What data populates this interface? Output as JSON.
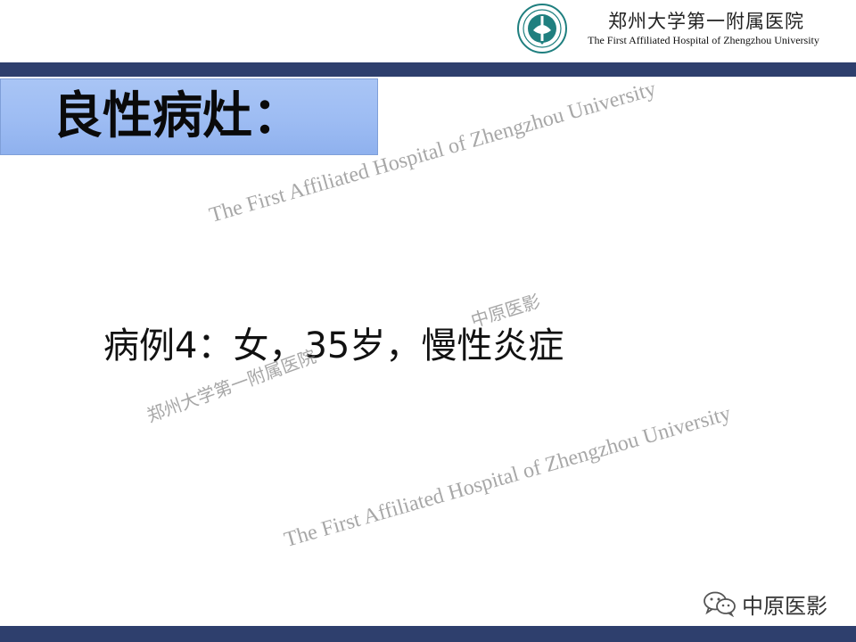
{
  "header": {
    "hospital_name_cn": "郑州大学第一附属医院",
    "hospital_name_en": "The First Affiliated Hospital of Zhengzhou University",
    "logo_icon": "hospital-seal-icon"
  },
  "slide": {
    "title": "良性病灶：",
    "case_line": "病例4：女，35岁，慢性炎症"
  },
  "watermarks": {
    "en_1": "The First Affiliated Hospital of Zhengzhou University",
    "en_2": "The First Affiliated Hospital of Zhengzhou University",
    "cn_center": "中原医影",
    "cn_hospital": "郑州大学第一附属医院"
  },
  "brand": {
    "label": "中原医影",
    "icon": "wechat-icon"
  },
  "colors": {
    "bar": "#2e3f6d",
    "title_box": "#9dbcf3",
    "logo_teal": "#1f7f7f"
  }
}
